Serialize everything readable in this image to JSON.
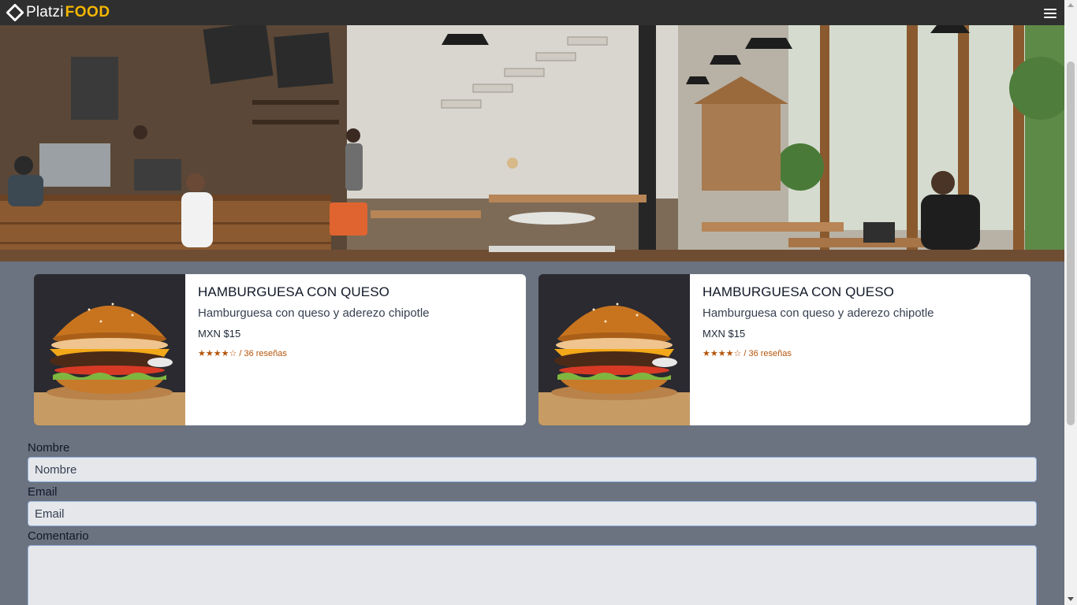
{
  "header": {
    "logo_text": "Platzi",
    "logo_accent": "FOOD",
    "menu_icon": "hamburger-menu-icon"
  },
  "hero": {
    "image": "cafe-interior-photo"
  },
  "cards": [
    {
      "title": "HAMBURGUESA CON QUESO",
      "description": "Hamburguesa con queso y aderezo chipotle",
      "price": "MXN $15",
      "rating": "★★★★☆ / 36 reseñas",
      "image": "cheeseburger-photo"
    },
    {
      "title": "HAMBURGUESA CON QUESO",
      "description": "Hamburguesa con queso y aderezo chipotle",
      "price": "MXN $15",
      "rating": "★★★★☆ / 36 reseñas",
      "image": "cheeseburger-photo"
    }
  ],
  "form": {
    "name_label": "Nombre",
    "name_placeholder": "Nombre",
    "email_label": "Email",
    "email_placeholder": "Email",
    "comment_label": "Comentario",
    "comment_value": ""
  },
  "colors": {
    "header_bg": "#2f2f2f",
    "accent": "#f5b700",
    "page_bg": "#6b7280",
    "rating": "#b45309",
    "input_bg": "#e5e7eb",
    "input_border": "#93b4dc"
  }
}
